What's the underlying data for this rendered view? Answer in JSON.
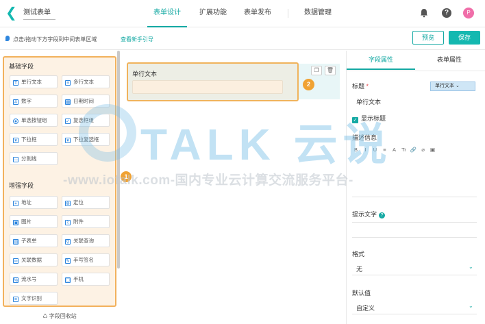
{
  "header": {
    "back_icon": "chevron-left-icon",
    "form_title": "测试表单",
    "nav": [
      "表单设计",
      "扩展功能",
      "表单发布",
      "数据管理"
    ],
    "active_nav": "表单设计",
    "avatar_letter": "P",
    "help_glyph": "?"
  },
  "toolbar": {
    "tip": "点击/拖动下方字段到中间表单区域",
    "guide_link": "查看新手引导",
    "preview_label": "预览",
    "save_label": "保存"
  },
  "left_panel": {
    "basic_title": "基础字段",
    "basic_fields": [
      "单行文本",
      "多行文本",
      "数字",
      "日期时间",
      "单选按钮组",
      "复选框组",
      "下拉框",
      "下拉复选框",
      "分割线"
    ],
    "enhanced_title": "增强字段",
    "enhanced_fields": [
      "地址",
      "定位",
      "图片",
      "附件",
      "子表单",
      "关联查询",
      "关联数据",
      "手写签名",
      "流水号",
      "手机",
      "文字识别"
    ],
    "recycle_label": "字段回收站",
    "badge": "1"
  },
  "canvas": {
    "field_label": "单行文本",
    "badge": "2"
  },
  "right_panel": {
    "tabs": [
      "字段属性",
      "表单属性"
    ],
    "active_tab": "字段属性",
    "title_label": "标题",
    "required_mark": "*",
    "title_value": "单行文本",
    "title_type_select": "单行文本",
    "show_title_label": "显示标题",
    "show_title_checked": true,
    "description_label": "描述信息",
    "editor_tools": [
      "B",
      "I",
      "U",
      "≡",
      "A",
      "Tr",
      "🔗",
      "⌀",
      "▣"
    ],
    "placeholder_label": "提示文字",
    "format_label": "格式",
    "format_value": "无",
    "default_label": "默认值",
    "default_value": "自定义"
  },
  "watermark": {
    "logo_text": "TALK 云说",
    "url_text": "-www.iotalk.com-国内专业云计算交流服务平台-"
  },
  "colors": {
    "accent": "#14a9a3",
    "highlight": "#f0a233"
  }
}
